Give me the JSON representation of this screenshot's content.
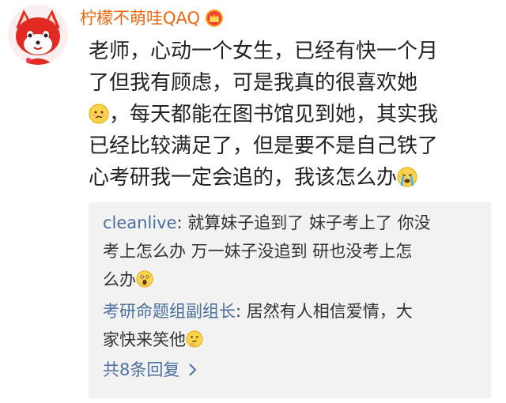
{
  "post": {
    "username": "柠檬不萌哇QAQ",
    "avatar_icon": "red-fox-avatar-icon",
    "badge_icon": "crown-vip-icon",
    "lines": {
      "l1": "老师，心动一个女生，已经有快一个月",
      "l2": "了但我有顾虑，可是我真的很喜欢她",
      "l3": "，每天都能在图书馆见到她，其实我",
      "l4": "已经比较满足了，但是要不是自己铁了",
      "l5": "心考研我一定会追的，我该怎么办"
    },
    "emojis": [
      "sad-face-icon",
      "crying-face-icon"
    ]
  },
  "replies": [
    {
      "user": "cleanlive",
      "sep": ": ",
      "lines": [
        "就算妹子追到了 妹子考上了 你没",
        "考上怎么办 万一妹子没追到 研也没考上怎",
        "么办"
      ],
      "emoji": "shocked-face-icon"
    },
    {
      "user": "考研命题组副组长",
      "sep": ": ",
      "lines": [
        "居然有人相信爱情，大",
        "家快来笑他"
      ],
      "emoji": "thinking-face-icon"
    }
  ],
  "more_replies_label": "共8条回复",
  "colors": {
    "username": "#e8670f",
    "reply_user": "#4a6f9c",
    "reply_bg": "#f2f2f2",
    "text": "#222222"
  }
}
